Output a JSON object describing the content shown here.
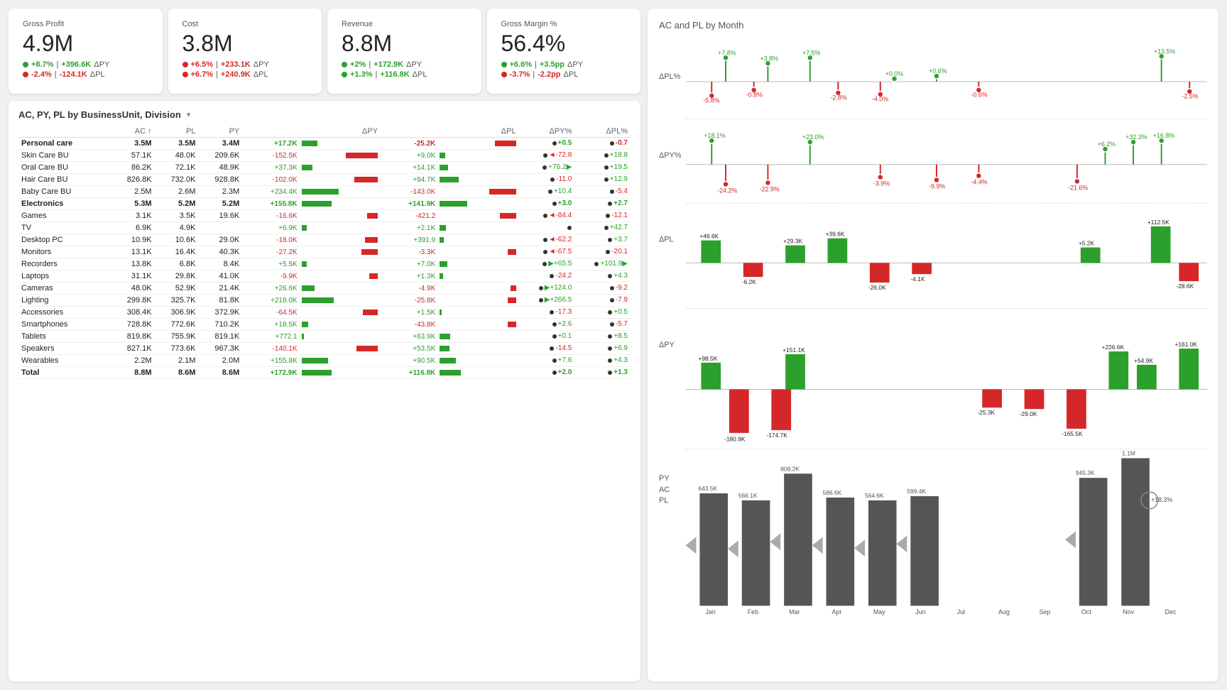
{
  "kpis": [
    {
      "label": "Gross Profit",
      "value": "4.9M",
      "metrics": [
        {
          "type": "green",
          "pct": "+8.7%",
          "abs": "+396.6K",
          "tag": "ΔPY"
        },
        {
          "type": "red",
          "pct": "-2.4%",
          "abs": "-124.1K",
          "tag": "ΔPL"
        }
      ]
    },
    {
      "label": "Cost",
      "value": "3.8M",
      "metrics": [
        {
          "type": "red",
          "pct": "+6.5%",
          "abs": "+233.1K",
          "tag": "ΔPY"
        },
        {
          "type": "red",
          "pct": "+6.7%",
          "abs": "+240.9K",
          "tag": "ΔPL"
        }
      ]
    },
    {
      "label": "Revenue",
      "value": "8.8M",
      "metrics": [
        {
          "type": "green",
          "pct": "+2%",
          "abs": "+172.9K",
          "tag": "ΔPY"
        },
        {
          "type": "green",
          "pct": "+1.3%",
          "abs": "+116.8K",
          "tag": "ΔPL"
        }
      ]
    },
    {
      "label": "Gross Margin %",
      "value": "56.4%",
      "metrics": [
        {
          "type": "green",
          "pct": "+6.6%",
          "abs": "+3.5pp",
          "tag": "ΔPY"
        },
        {
          "type": "red",
          "pct": "-3.7%",
          "abs": "-2.2pp",
          "tag": "ΔPL"
        }
      ]
    }
  ],
  "table": {
    "title": "AC, PY, PL by BusinessUnit, Division",
    "columns": [
      "AC ↑",
      "PL",
      "PY",
      "ΔPY",
      "ΔPL",
      "ΔPY%",
      "ΔPL%"
    ],
    "rows": [
      {
        "name": "Personal care",
        "ac": "3.5M",
        "pl": "3.5M",
        "py": "3.4M",
        "dpy": "+17.2K",
        "dpl": "-25.2K",
        "dpyp": "+0.5",
        "dplp": "-0.7",
        "bold": true,
        "dpy_bar": 15,
        "dpy_pos": true,
        "dpl_bar": 20,
        "dpl_pos": false
      },
      {
        "name": "Skin Care BU",
        "ac": "57.1K",
        "pl": "48.0K",
        "py": "209.6K",
        "dpy": "-152.5K",
        "dpl": "+9.0K",
        "dpyp": "◄-72.8",
        "dplp": "+18.8",
        "dpy_bar": -30,
        "dpy_pos": false,
        "dpl_bar": 5,
        "dpl_pos": true
      },
      {
        "name": "Oral Care BU",
        "ac": "86.2K",
        "pl": "72.1K",
        "py": "48.9K",
        "dpy": "+37.3K",
        "dpl": "+14.1K",
        "dpyp": "+76.2▶",
        "dplp": "+19.5",
        "dpy_bar": 10,
        "dpy_pos": true,
        "dpl_bar": 8,
        "dpl_pos": true
      },
      {
        "name": "Hair Care BU",
        "ac": "826.8K",
        "pl": "732.0K",
        "py": "928.8K",
        "dpy": "-102.0K",
        "dpl": "+94.7K",
        "dpyp": "-11.0",
        "dplp": "+12.9",
        "dpy_bar": -22,
        "dpy_pos": false,
        "dpl_bar": 18,
        "dpl_pos": true
      },
      {
        "name": "Baby Care BU",
        "ac": "2.5M",
        "pl": "2.6M",
        "py": "2.3M",
        "dpy": "+234.4K",
        "dpl": "-143.0K",
        "dpyp": "+10.4",
        "dplp": "-5.4",
        "dpy_bar": 35,
        "dpy_pos": true,
        "dpl_bar": -25,
        "dpl_pos": false
      },
      {
        "name": "Electronics",
        "ac": "5.3M",
        "pl": "5.2M",
        "py": "5.2M",
        "dpy": "+155.8K",
        "dpl": "+141.9K",
        "dpyp": "+3.0",
        "dplp": "+2.7",
        "bold": true,
        "dpy_bar": 28,
        "dpy_pos": true,
        "dpl_bar": 26,
        "dpl_pos": true
      },
      {
        "name": "Games",
        "ac": "3.1K",
        "pl": "3.5K",
        "py": "19.6K",
        "dpy": "-16.6K",
        "dpl": "-421.2",
        "dpyp": "◄-84.4",
        "dplp": "-12.1",
        "dpy_bar": -10,
        "dpy_pos": false,
        "dpl_bar": -15,
        "dpl_pos": false
      },
      {
        "name": "TV",
        "ac": "6.9K",
        "pl": "4.9K",
        "py": "",
        "dpy": "+6.9K",
        "dpl": "+2.1K",
        "dpyp": "",
        "dplp": "+42.7",
        "dpy_bar": 5,
        "dpy_pos": true,
        "dpl_bar": 6,
        "dpl_pos": true
      },
      {
        "name": "Desktop PC",
        "ac": "10.9K",
        "pl": "10.6K",
        "py": "29.0K",
        "dpy": "-18.0K",
        "dpl": "+391.9",
        "dpyp": "◄-62.2",
        "dplp": "+3.7",
        "dpy_bar": -12,
        "dpy_pos": false,
        "dpl_bar": 4,
        "dpl_pos": true
      },
      {
        "name": "Monitors",
        "ac": "13.1K",
        "pl": "16.4K",
        "py": "40.3K",
        "dpy": "-27.2K",
        "dpl": "-3.3K",
        "dpyp": "◄-67.5",
        "dplp": "-20.1",
        "dpy_bar": -15,
        "dpy_pos": false,
        "dpl_bar": -8,
        "dpl_pos": false
      },
      {
        "name": "Recorders",
        "ac": "13.8K",
        "pl": "6.8K",
        "py": "8.4K",
        "dpy": "+5.5K",
        "dpl": "+7.0K",
        "dpyp": "▶+65.5",
        "dplp": "+101.9▶",
        "dpy_bar": 5,
        "dpy_pos": true,
        "dpl_bar": 7,
        "dpl_pos": true
      },
      {
        "name": "Laptops",
        "ac": "31.1K",
        "pl": "29.8K",
        "py": "41.0K",
        "dpy": "-9.9K",
        "dpl": "+1.3K",
        "dpyp": "-24.2",
        "dplp": "+4.3",
        "dpy_bar": -8,
        "dpy_pos": false,
        "dpl_bar": 3,
        "dpl_pos": true
      },
      {
        "name": "Cameras",
        "ac": "48.0K",
        "pl": "52.9K",
        "py": "21.4K",
        "dpy": "+26.6K",
        "dpl": "-4.9K",
        "dpyp": "▶+124.0",
        "dplp": "-9.2",
        "dpy_bar": 12,
        "dpy_pos": true,
        "dpl_bar": -5,
        "dpl_pos": false
      },
      {
        "name": "Lighting",
        "ac": "299.8K",
        "pl": "325.7K",
        "py": "81.8K",
        "dpy": "+218.0K",
        "dpl": "-25.8K",
        "dpyp": "▶+266.5",
        "dplp": "-7.9",
        "dpy_bar": 30,
        "dpy_pos": true,
        "dpl_bar": -8,
        "dpl_pos": false
      },
      {
        "name": "Accessories",
        "ac": "308.4K",
        "pl": "306.9K",
        "py": "372.9K",
        "dpy": "-64.5K",
        "dpl": "+1.5K",
        "dpyp": "-17.3",
        "dplp": "+0.5",
        "dpy_bar": -14,
        "dpy_pos": false,
        "dpl_bar": 2,
        "dpl_pos": true
      },
      {
        "name": "Smartphones",
        "ac": "728.8K",
        "pl": "772.6K",
        "py": "710.2K",
        "dpy": "+18.5K",
        "dpl": "-43.8K",
        "dpyp": "+2.6",
        "dplp": "-5.7",
        "dpy_bar": 6,
        "dpy_pos": true,
        "dpl_bar": -8,
        "dpl_pos": false
      },
      {
        "name": "Tablets",
        "ac": "819.8K",
        "pl": "755.9K",
        "py": "819.1K",
        "dpy": "+772.1",
        "dpl": "+63.9K",
        "dpyp": "+0.1",
        "dplp": "+8.5",
        "dpy_bar": 2,
        "dpy_pos": true,
        "dpl_bar": 10,
        "dpl_pos": true
      },
      {
        "name": "Speakers",
        "ac": "827.1K",
        "pl": "773.6K",
        "py": "967.3K",
        "dpy": "-140.1K",
        "dpl": "+53.5K",
        "dpyp": "-14.5",
        "dplp": "+6.9",
        "dpy_bar": -20,
        "dpy_pos": false,
        "dpl_bar": 9,
        "dpl_pos": true
      },
      {
        "name": "Wearables",
        "ac": "2.2M",
        "pl": "2.1M",
        "py": "2.0M",
        "dpy": "+155.8K",
        "dpl": "+90.5K",
        "dpyp": "+7.6",
        "dplp": "+4.3",
        "dpy_bar": 25,
        "dpy_pos": true,
        "dpl_bar": 15,
        "dpl_pos": true
      },
      {
        "name": "Total",
        "ac": "8.8M",
        "pl": "8.6M",
        "py": "8.6M",
        "dpy": "+172.9K",
        "dpl": "+116.8K",
        "dpyp": "+2.0",
        "dplp": "+1.3",
        "bold": true,
        "dpy_bar": 28,
        "dpy_pos": true,
        "dpl_bar": 20,
        "dpl_pos": true
      }
    ]
  },
  "right_chart": {
    "title": "AC and PL by Month",
    "months": [
      "Jan",
      "Feb",
      "Mar",
      "Apr",
      "May",
      "Jun",
      "Jul",
      "Aug",
      "Sep",
      "Oct",
      "Nov",
      "Dec"
    ],
    "dpl_labels": [
      "+7.8%",
      "+3.8%",
      "+7.5%",
      "+0.0%",
      "+0.6%",
      "+13.5%"
    ],
    "dpl_neg_labels": [
      "-5.8%",
      "-0.8%",
      "-2.8%",
      "-4.0%",
      "-0.6%",
      "-2.5%"
    ],
    "dpy_pos_labels": [
      "+18.1%",
      "+23.0%",
      "+16.8%",
      "+6.2%",
      "+32.3%"
    ],
    "dpy_neg_labels": [
      "-24.2%",
      "-22.9%",
      "-3.9%",
      "-9.9%",
      "-4.4%",
      "-21.6%"
    ],
    "dpl_bar_pos": [
      46.6,
      29.3,
      39.6,
      5.2,
      112.5
    ],
    "dpl_bar_neg": [
      6.2,
      26.0,
      4.1,
      28.6
    ],
    "dpy_bar_pos": [
      98.5,
      151.1,
      226.6,
      54.9,
      161.0
    ],
    "dpy_bar_neg": [
      180.9,
      174.7,
      25.3,
      29.0,
      165.5
    ],
    "py_bars": [
      643,
      566.1,
      808.2,
      586.6,
      564.6,
      599.4,
      945.3,
      1100
    ],
    "py_bar_labels": [
      "643.5K",
      "566.1K",
      "808.2K",
      "586.6K",
      "564.6K",
      "599.4K",
      "945.3K",
      "1.1M"
    ]
  }
}
